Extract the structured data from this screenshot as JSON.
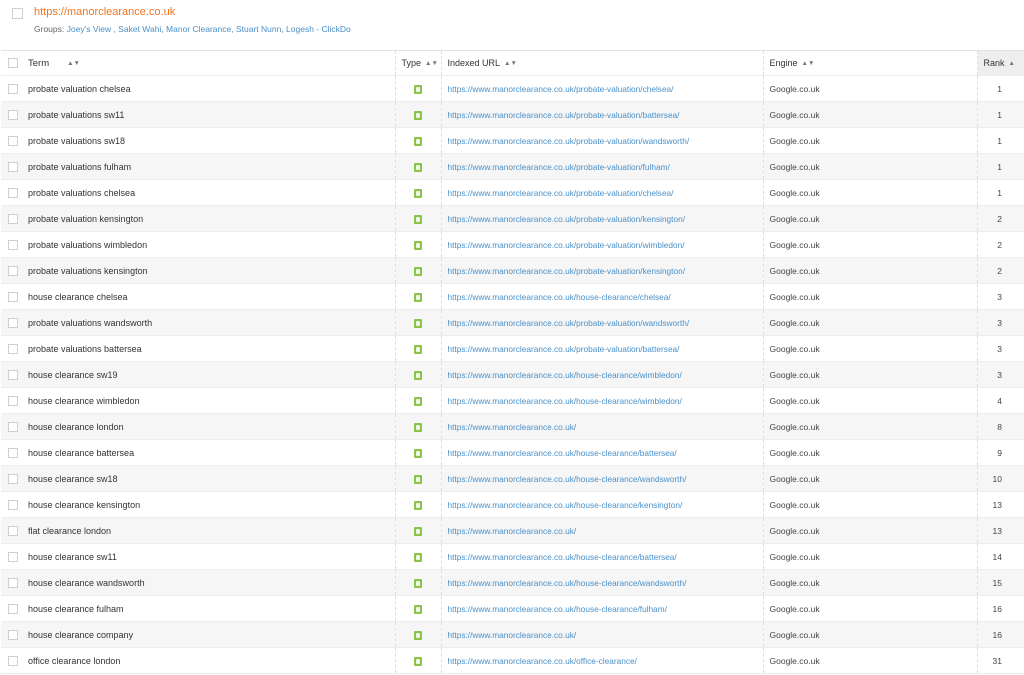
{
  "site": {
    "url": "https://manorclearance.co.uk",
    "groups_label": "Groups:",
    "groups_list": "Joey's View , Saket Wahi, Manor Clearance, Stuart Nunn, Logesh - ClickDo"
  },
  "columns": {
    "term": "Term",
    "type": "Type",
    "indexed_url": "Indexed URL",
    "engine": "Engine",
    "rank": "Rank"
  },
  "icons": {
    "sort": "sort-both-icon",
    "sort_active": "sort-up-icon",
    "type": "organic-result-icon"
  },
  "colors": {
    "site_url": "#f07522",
    "link": "#4a90c8",
    "type_badge": "#8cc34a"
  },
  "rows": [
    {
      "term": "probate valuation chelsea",
      "url": "https://www.manorclearance.co.uk/probate-valuation/chelsea/",
      "engine": "Google.co.uk",
      "rank": "1"
    },
    {
      "term": "probate valuations sw11",
      "url": "https://www.manorclearance.co.uk/probate-valuation/battersea/",
      "engine": "Google.co.uk",
      "rank": "1"
    },
    {
      "term": "probate valuations sw18",
      "url": "https://www.manorclearance.co.uk/probate-valuation/wandsworth/",
      "engine": "Google.co.uk",
      "rank": "1"
    },
    {
      "term": "probate valuations fulham",
      "url": "https://www.manorclearance.co.uk/probate-valuation/fulham/",
      "engine": "Google.co.uk",
      "rank": "1"
    },
    {
      "term": "probate valuations chelsea",
      "url": "https://www.manorclearance.co.uk/probate-valuation/chelsea/",
      "engine": "Google.co.uk",
      "rank": "1"
    },
    {
      "term": "probate valuation kensington",
      "url": "https://www.manorclearance.co.uk/probate-valuation/kensington/",
      "engine": "Google.co.uk",
      "rank": "2"
    },
    {
      "term": "probate valuations wimbledon",
      "url": "https://www.manorclearance.co.uk/probate-valuation/wimbledon/",
      "engine": "Google.co.uk",
      "rank": "2"
    },
    {
      "term": "probate valuations kensington",
      "url": "https://www.manorclearance.co.uk/probate-valuation/kensington/",
      "engine": "Google.co.uk",
      "rank": "2"
    },
    {
      "term": "house clearance chelsea",
      "url": "https://www.manorclearance.co.uk/house-clearance/chelsea/",
      "engine": "Google.co.uk",
      "rank": "3"
    },
    {
      "term": "probate valuations wandsworth",
      "url": "https://www.manorclearance.co.uk/probate-valuation/wandsworth/",
      "engine": "Google.co.uk",
      "rank": "3"
    },
    {
      "term": "probate valuations battersea",
      "url": "https://www.manorclearance.co.uk/probate-valuation/battersea/",
      "engine": "Google.co.uk",
      "rank": "3"
    },
    {
      "term": "house clearance sw19",
      "url": "https://www.manorclearance.co.uk/house-clearance/wimbledon/",
      "engine": "Google.co.uk",
      "rank": "3"
    },
    {
      "term": "house clearance wimbledon",
      "url": "https://www.manorclearance.co.uk/house-clearance/wimbledon/",
      "engine": "Google.co.uk",
      "rank": "4"
    },
    {
      "term": "house clearance london",
      "url": "https://www.manorclearance.co.uk/",
      "engine": "Google.co.uk",
      "rank": "8"
    },
    {
      "term": "house clearance battersea",
      "url": "https://www.manorclearance.co.uk/house-clearance/battersea/",
      "engine": "Google.co.uk",
      "rank": "9"
    },
    {
      "term": "house clearance sw18",
      "url": "https://www.manorclearance.co.uk/house-clearance/wandsworth/",
      "engine": "Google.co.uk",
      "rank": "10"
    },
    {
      "term": "house clearance kensington",
      "url": "https://www.manorclearance.co.uk/house-clearance/kensington/",
      "engine": "Google.co.uk",
      "rank": "13"
    },
    {
      "term": "flat clearance london",
      "url": "https://www.manorclearance.co.uk/",
      "engine": "Google.co.uk",
      "rank": "13"
    },
    {
      "term": "house clearance sw11",
      "url": "https://www.manorclearance.co.uk/house-clearance/battersea/",
      "engine": "Google.co.uk",
      "rank": "14"
    },
    {
      "term": "house clearance wandsworth",
      "url": "https://www.manorclearance.co.uk/house-clearance/wandsworth/",
      "engine": "Google.co.uk",
      "rank": "15"
    },
    {
      "term": "house clearance fulham",
      "url": "https://www.manorclearance.co.uk/house-clearance/fulham/",
      "engine": "Google.co.uk",
      "rank": "16"
    },
    {
      "term": "house clearance company",
      "url": "https://www.manorclearance.co.uk/",
      "engine": "Google.co.uk",
      "rank": "16"
    },
    {
      "term": "office clearance london",
      "url": "https://www.manorclearance.co.uk/office-clearance/",
      "engine": "Google.co.uk",
      "rank": "31"
    }
  ]
}
